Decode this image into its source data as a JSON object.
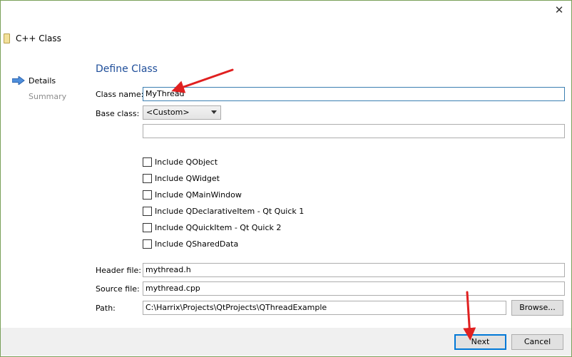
{
  "window": {
    "title": "C++ Class",
    "close_symbol": "✕"
  },
  "nav": {
    "items": [
      {
        "label": "Details",
        "active": true
      },
      {
        "label": "Summary",
        "active": false
      }
    ]
  },
  "page": {
    "heading": "Define Class"
  },
  "form": {
    "class_name_label": "Class name:",
    "class_name_value": "MyThread",
    "base_class_label": "Base class:",
    "base_class_value": "<Custom>",
    "custom_base_value": "",
    "checkboxes": [
      {
        "label": "Include QObject",
        "checked": false
      },
      {
        "label": "Include QWidget",
        "checked": false
      },
      {
        "label": "Include QMainWindow",
        "checked": false
      },
      {
        "label": "Include QDeclarativeItem - Qt Quick 1",
        "checked": false
      },
      {
        "label": "Include QQuickItem - Qt Quick 2",
        "checked": false
      },
      {
        "label": "Include QSharedData",
        "checked": false
      }
    ],
    "header_file_label": "Header file:",
    "header_file_value": "mythread.h",
    "source_file_label": "Source file:",
    "source_file_value": "mythread.cpp",
    "path_label": "Path:",
    "path_value": "C:\\Harrix\\Projects\\QtProjects\\QThreadExample",
    "browse_label": "Browse..."
  },
  "footer": {
    "next_label": "Next",
    "cancel_label": "Cancel"
  },
  "colors": {
    "accent": "#0078d7",
    "heading": "#1f4e9a",
    "annotation_arrow": "#e02020"
  },
  "icons": {
    "class_icon": "file-icon",
    "nav_current": "arrow-right-icon",
    "close": "close-icon"
  }
}
